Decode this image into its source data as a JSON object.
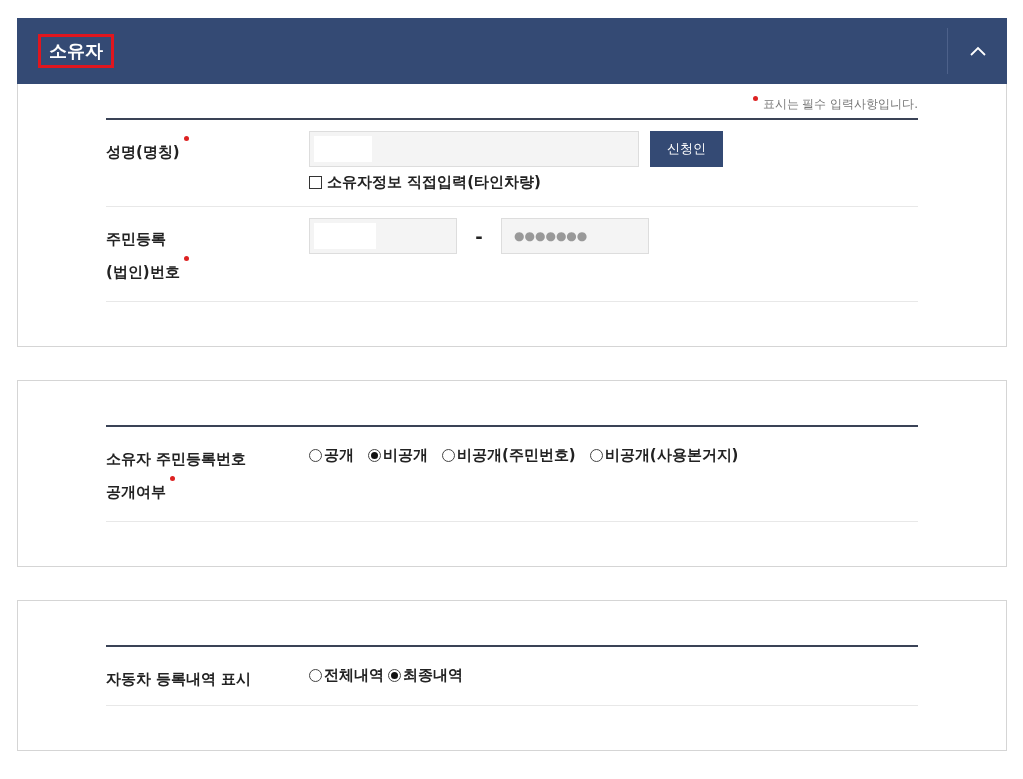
{
  "owner_panel": {
    "title": "소유자",
    "title_highlighted": true,
    "expanded": true,
    "required_note": "표시는 필수 입력사항입니다.",
    "rows": [
      {
        "kind": "name",
        "label_lines": [
          "성명(명칭)"
        ],
        "required": true,
        "field": {
          "masked": true
        },
        "button": "신청인",
        "checkbox": {
          "label": "소유자정보 직접입력(타인차량)",
          "checked": false
        }
      },
      {
        "kind": "id",
        "label_lines": [
          "주민등록",
          "(법인)번호"
        ],
        "required": true,
        "field": {
          "masked": true
        },
        "separator": "-",
        "second_field": {
          "placeholder": "●●●●●●●"
        }
      }
    ]
  },
  "disclosure_panel": {
    "label_lines": [
      "소유자 주민등록번호",
      "공개여부"
    ],
    "required": true,
    "options": [
      {
        "label": "공개",
        "selected": false
      },
      {
        "label": "비공개",
        "selected": true
      },
      {
        "label": "비공개(주민번호)",
        "selected": false
      },
      {
        "label": "비공개(사용본거지)",
        "selected": false
      }
    ]
  },
  "history_panel": {
    "label_lines": [
      "자동차 등록내역 표시"
    ],
    "required": false,
    "options": [
      {
        "label": "전체내역",
        "selected": false
      },
      {
        "label": "최종내역",
        "selected": true
      }
    ]
  }
}
